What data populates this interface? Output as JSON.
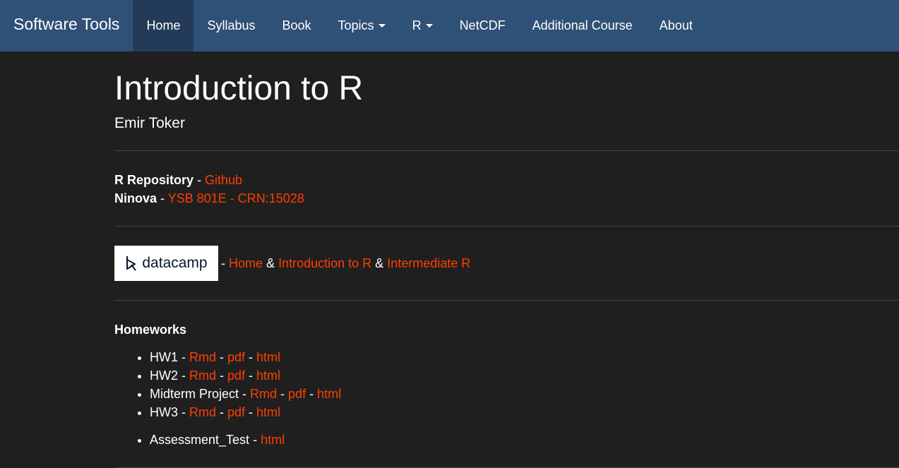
{
  "navbar": {
    "brand": "Software Tools",
    "items": [
      {
        "label": "Home",
        "active": true
      },
      {
        "label": "Syllabus"
      },
      {
        "label": "Book"
      },
      {
        "label": "Topics",
        "dropdown": true
      },
      {
        "label": "R",
        "dropdown": true
      },
      {
        "label": "NetCDF"
      },
      {
        "label": "Additional Course"
      },
      {
        "label": "About"
      }
    ]
  },
  "page": {
    "title": "Introduction to R",
    "author": "Emir Toker"
  },
  "repo": {
    "r_label": "R Repository",
    "sep": " - ",
    "r_link": "Github",
    "ninova_label": "Ninova",
    "ninova_link": "YSB 801E - CRN:15028"
  },
  "datacamp": {
    "logo_text": "datacamp",
    "sep": " - ",
    "link_home": "Home",
    "amp": " & ",
    "link_intro": "Introduction to R",
    "link_intermediate": "Intermediate R"
  },
  "homeworks": {
    "title": "Homeworks",
    "items": [
      {
        "name": "HW1",
        "rmd": "Rmd",
        "pdf": "pdf",
        "html": "html"
      },
      {
        "name": "HW2",
        "rmd": "Rmd",
        "pdf": "pdf",
        "html": "html"
      },
      {
        "name": "Midterm Project",
        "rmd": "Rmd",
        "pdf": "pdf",
        "html": "html"
      },
      {
        "name": "HW3",
        "rmd": "Rmd",
        "pdf": "pdf",
        "html": "html"
      }
    ],
    "extra": {
      "name": "Assessment_Test",
      "html": "html"
    },
    "sep": " - "
  },
  "colors": {
    "navbar_bg": "#2f5077",
    "navbar_active": "#233b58",
    "page_bg": "#1f1f1f",
    "link": "#ff3f00"
  }
}
